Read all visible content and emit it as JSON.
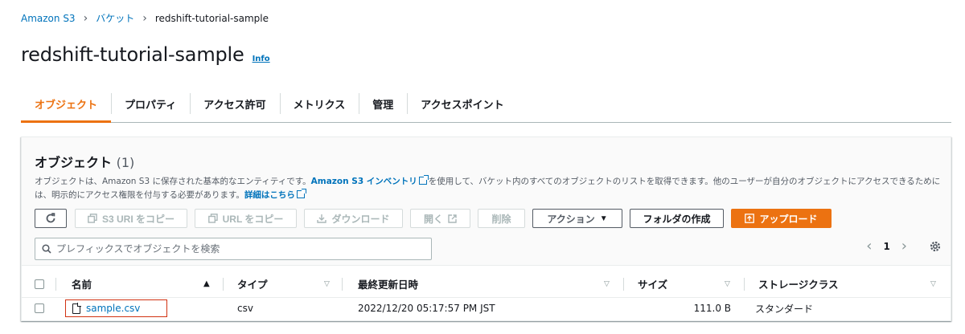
{
  "breadcrumb": {
    "root": "Amazon S3",
    "parent": "バケット",
    "current": "redshift-tutorial-sample"
  },
  "page": {
    "title": "redshift-tutorial-sample",
    "info": "Info"
  },
  "tabs": [
    {
      "label": "オブジェクト",
      "active": true
    },
    {
      "label": "プロパティ"
    },
    {
      "label": "アクセス許可"
    },
    {
      "label": "メトリクス"
    },
    {
      "label": "管理"
    },
    {
      "label": "アクセスポイント"
    }
  ],
  "panel": {
    "title": "オブジェクト",
    "count": "(1)",
    "desc_1": "オブジェクトは、Amazon S3 に保存された基本的なエンティティです。",
    "desc_link_1": "Amazon S3 インベントリ",
    "desc_2": "を使用して、バケット内のすべてのオブジェクトのリストを取得できます。他のユーザーが自分のオブジェクトにアクセスできるためには、明示的にアクセス権限を付与する必要があります。",
    "desc_link_2": "詳細はこちら"
  },
  "toolbar": {
    "copy_s3_uri": "S3 URI をコピー",
    "copy_url": "URL をコピー",
    "download": "ダウンロード",
    "open": "開く",
    "delete": "削除",
    "actions": "アクション",
    "create_folder": "フォルダの作成",
    "upload": "アップロード"
  },
  "search": {
    "placeholder": "プレフィックスでオブジェクトを検索"
  },
  "pager": {
    "page": "1"
  },
  "table": {
    "headers": {
      "name": "名前",
      "type": "タイプ",
      "modified": "最終更新日時",
      "size": "サイズ",
      "storage": "ストレージクラス"
    },
    "rows": [
      {
        "name": "sample.csv",
        "type": "csv",
        "modified": "2022/12/20 05:17:57 PM JST",
        "size": "111.0 B",
        "storage": "スタンダード"
      }
    ]
  },
  "colors": {
    "accent": "#ec7211",
    "link": "#0073bb",
    "highlight": "#d13212"
  }
}
